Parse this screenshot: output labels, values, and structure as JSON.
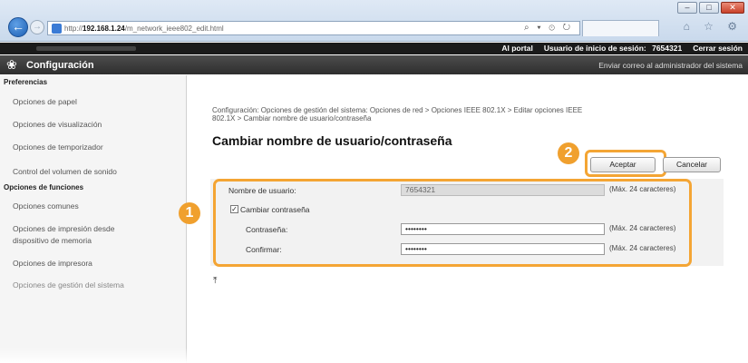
{
  "browser": {
    "url_prefix": "http://",
    "url_host": "192.168.1.24",
    "url_path": "/m_network_ieee802_edit.html",
    "address_tools": "⌕ ▾ ⊙ ↻",
    "back_glyph": "←",
    "forward_glyph": "→",
    "window_buttons": [
      "–",
      "□",
      "✕"
    ],
    "toolbar_icons": "⌂ ☆ ⚙"
  },
  "topbar": {
    "portal_link": "Al portal",
    "login_user_label": "Usuario de inicio de sesión:",
    "login_user_value": "7654321",
    "logout_link": "Cerrar sesión"
  },
  "titlebar": {
    "icon": "gear-icon",
    "title": "Configuración",
    "mail_link": "Enviar correo al administrador del sistema"
  },
  "sidebar": {
    "sections": [
      {
        "heading": "Preferencias"
      },
      {
        "heading": "Opciones de funciones"
      }
    ],
    "items": [
      "Opciones de papel",
      "Opciones de visualización",
      "Opciones de temporizador",
      "Control del volumen de sonido",
      "Opciones comunes",
      "Opciones de impresión desde",
      "dispositivo de memoria",
      "Opciones de impresora",
      "Opciones de gestión del sistema"
    ]
  },
  "main": {
    "breadcrumb_line1": "Configuración: Opciones de gestión del sistema: Opciones de red > Opciones IEEE 802.1X > Editar opciones IEEE",
    "breadcrumb_line2": "802.1X > Cambiar nombre de usuario/contraseña",
    "heading": "Cambiar nombre de usuario/contraseña",
    "accept_button": "Aceptar",
    "cancel_button": "Cancelar",
    "form": {
      "username_label": "Nombre de usuario:",
      "username_value": "7654321",
      "username_note": "(Máx. 24 caracteres)",
      "change_password_label": "Cambiar contraseña",
      "change_password_checked": "✓",
      "password_label": "Contraseña:",
      "password_value": "••••••••",
      "password_note": "(Máx. 24 caracteres)",
      "confirm_label": "Confirmar:",
      "confirm_value": "••••••••",
      "confirm_note": "(Máx. 24 caracteres)"
    },
    "top_icon": "⤒"
  },
  "callouts": {
    "one": "1",
    "two": "2",
    "color": "#f4a534"
  }
}
